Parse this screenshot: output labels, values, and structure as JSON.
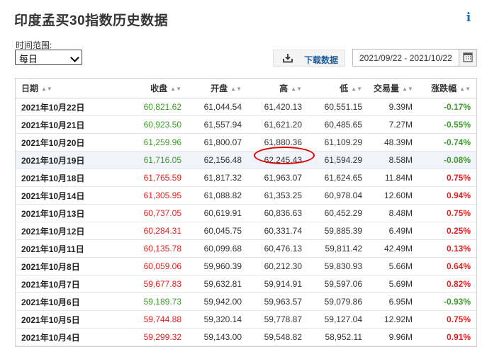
{
  "header": {
    "title": "印度孟买30指数历史数据",
    "info_label": "i"
  },
  "controls": {
    "range_label": "时间范围:",
    "range_value": "每日",
    "download_label": "下载数据",
    "date_range": "2021/09/22 - 2021/10/22"
  },
  "table": {
    "columns": [
      "日期",
      "收盘",
      "开盘",
      "高",
      "低",
      "交易量",
      "涨跌幅"
    ],
    "rows": [
      {
        "date": "2021年10月22日",
        "close": "60,821.62",
        "open": "61,044.54",
        "high": "61,420.13",
        "low": "60,551.15",
        "volume": "9.39M",
        "change": "-0.17%",
        "dir": "down"
      },
      {
        "date": "2021年10月21日",
        "close": "60,923.50",
        "open": "61,557.94",
        "high": "61,621.20",
        "low": "60,485.65",
        "volume": "7.27M",
        "change": "-0.55%",
        "dir": "down"
      },
      {
        "date": "2021年10月20日",
        "close": "61,259.96",
        "open": "61,800.07",
        "high": "61,880.36",
        "low": "61,109.29",
        "volume": "48.39M",
        "change": "-0.74%",
        "dir": "down"
      },
      {
        "date": "2021年10月19日",
        "close": "61,716.05",
        "open": "62,156.48",
        "high": "62,245.43",
        "low": "61,594.29",
        "volume": "8.58M",
        "change": "-0.08%",
        "dir": "down"
      },
      {
        "date": "2021年10月18日",
        "close": "61,765.59",
        "open": "61,817.32",
        "high": "61,963.07",
        "low": "61,624.65",
        "volume": "11.84M",
        "change": "0.75%",
        "dir": "up"
      },
      {
        "date": "2021年10月14日",
        "close": "61,305.95",
        "open": "61,088.82",
        "high": "61,353.25",
        "low": "60,978.04",
        "volume": "12.60M",
        "change": "0.94%",
        "dir": "up"
      },
      {
        "date": "2021年10月13日",
        "close": "60,737.05",
        "open": "60,619.91",
        "high": "60,836.63",
        "low": "60,452.29",
        "volume": "8.48M",
        "change": "0.75%",
        "dir": "up"
      },
      {
        "date": "2021年10月12日",
        "close": "60,284.31",
        "open": "60,045.75",
        "high": "60,331.74",
        "low": "59,885.39",
        "volume": "6.49M",
        "change": "0.25%",
        "dir": "up"
      },
      {
        "date": "2021年10月11日",
        "close": "60,135.78",
        "open": "60,099.68",
        "high": "60,476.13",
        "low": "59,811.42",
        "volume": "42.49M",
        "change": "0.13%",
        "dir": "up"
      },
      {
        "date": "2021年10月8日",
        "close": "60,059.06",
        "open": "59,960.39",
        "high": "60,212.30",
        "low": "59,830.93",
        "volume": "5.66M",
        "change": "0.64%",
        "dir": "up"
      },
      {
        "date": "2021年10月7日",
        "close": "59,677.83",
        "open": "59,632.81",
        "high": "59,914.91",
        "low": "59,597.06",
        "volume": "5.69M",
        "change": "0.82%",
        "dir": "up"
      },
      {
        "date": "2021年10月6日",
        "close": "59,189.73",
        "open": "59,942.00",
        "high": "59,963.57",
        "low": "59,079.86",
        "volume": "6.95M",
        "change": "-0.93%",
        "dir": "down"
      },
      {
        "date": "2021年10月5日",
        "close": "59,744.88",
        "open": "59,320.14",
        "high": "59,778.87",
        "low": "59,127.04",
        "volume": "12.92M",
        "change": "0.75%",
        "dir": "up"
      },
      {
        "date": "2021年10月4日",
        "close": "59,299.32",
        "open": "59,143.00",
        "high": "59,548.82",
        "low": "58,952.11",
        "volume": "9.96M",
        "change": "0.91%",
        "dir": "up"
      }
    ]
  },
  "colors": {
    "up": "#e02020",
    "down": "#3d9a2b",
    "accent": "#1f5f99",
    "annotation": "#e00000"
  },
  "highlight": {
    "row_index": 3,
    "column": "high"
  }
}
